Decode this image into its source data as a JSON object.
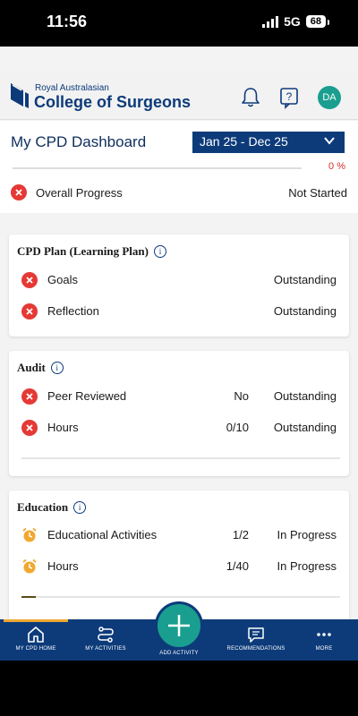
{
  "status_bar": {
    "time": "11:56",
    "network": "5G",
    "battery": "68"
  },
  "header": {
    "logo_small": "Royal Australasian",
    "logo_big": "College of Surgeons",
    "avatar_initials": "DA"
  },
  "dashboard": {
    "title": "My CPD Dashboard",
    "date_range": "Jan 25 - Dec 25",
    "progress_percent": "0 %",
    "overall_label": "Overall Progress",
    "overall_status": "Not Started"
  },
  "cards": {
    "plan": {
      "title": "CPD Plan (Learning Plan)",
      "rows": [
        {
          "label": "Goals",
          "value": "",
          "status": "Outstanding"
        },
        {
          "label": "Reflection",
          "value": "",
          "status": "Outstanding"
        }
      ]
    },
    "audit": {
      "title": "Audit",
      "rows": [
        {
          "label": "Peer Reviewed",
          "value": "No",
          "status": "Outstanding"
        },
        {
          "label": "Hours",
          "value": "0/10",
          "status": "Outstanding"
        }
      ]
    },
    "education": {
      "title": "Education",
      "rows": [
        {
          "label": "Educational Activities",
          "value": "1/2",
          "status": "In Progress"
        },
        {
          "label": "Hours",
          "value": "1/40",
          "status": "In Progress"
        }
      ]
    }
  },
  "bottom_nav": {
    "home": "MY CPD HOME",
    "activities": "MY ACTIVITIES",
    "add": "ADD ACTIVITY",
    "recommendations": "RECOMMENDATIONS",
    "more": "MORE"
  },
  "colors": {
    "brand": "#0d3b7a",
    "accent": "#1a9e8f",
    "error": "#e53935",
    "progress": "#f0a830"
  }
}
